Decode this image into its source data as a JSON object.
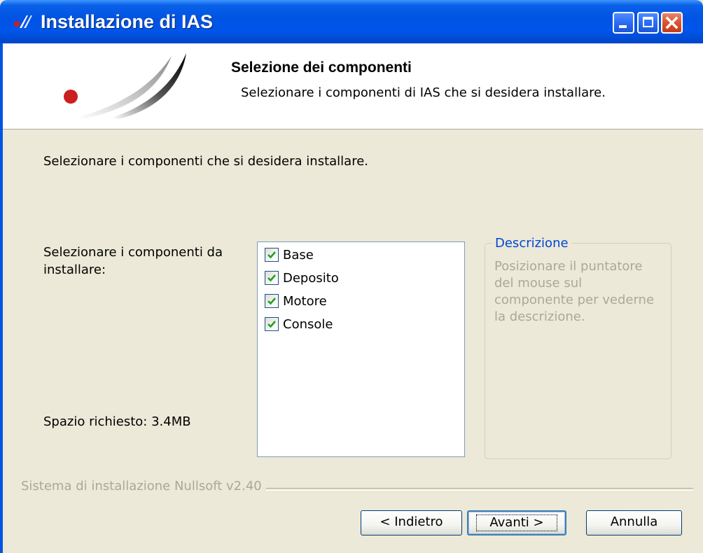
{
  "window": {
    "title": "Installazione di IAS",
    "buttons": [
      "minimize",
      "maximize",
      "close"
    ]
  },
  "header": {
    "title": "Selezione dei componenti",
    "subtitle": "Selezionare i componenti di IAS che si desidera installare."
  },
  "main": {
    "intro": "Selezionare i componenti che si desidera installare.",
    "select_label": "Selezionare i componenti da installare:",
    "space_required": "Spazio richiesto: 3.4MB",
    "components": [
      {
        "label": "Base",
        "checked": true
      },
      {
        "label": "Deposito",
        "checked": true
      },
      {
        "label": "Motore",
        "checked": true
      },
      {
        "label": "Console",
        "checked": true
      }
    ],
    "description": {
      "legend": "Descrizione",
      "text": "Posizionare il puntatore del mouse sul componente per vederne la descrizione."
    }
  },
  "footer": {
    "branding": "Sistema di installazione Nullsoft v2.40",
    "back_label": "< Indietro",
    "next_label": "Avanti >",
    "cancel_label": "Annulla"
  },
  "icons": {
    "app": "ias-logo-icon",
    "minimize": "minimize-icon",
    "maximize": "maximize-icon",
    "close": "close-icon",
    "check": "checkmark-icon"
  },
  "colors": {
    "titlebar": "#0054e3",
    "window_bg": "#ece9d8",
    "legend": "#0046d5",
    "disabled_text": "#aca899",
    "checkmark": "#21a121",
    "close_button": "#d9532f",
    "logo_dot": "#cc1f1f"
  }
}
